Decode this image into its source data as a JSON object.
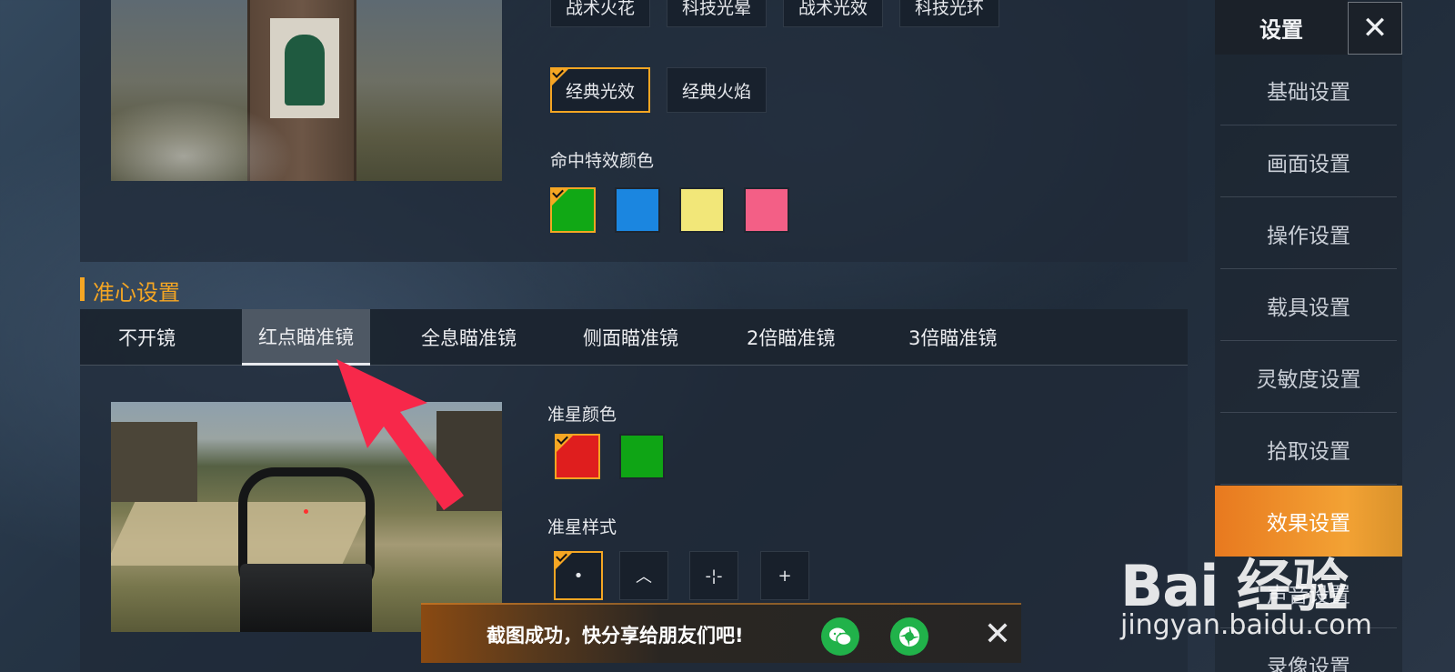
{
  "hit_effects": {
    "clipped_options": [
      "战术火花",
      "科技光晕",
      "战术光效",
      "科技光环"
    ],
    "options": [
      {
        "label": "经典光效",
        "selected": true
      },
      {
        "label": "经典火焰",
        "selected": false
      }
    ],
    "color_label": "命中特效颜色",
    "colors": [
      {
        "name": "green",
        "hex": "#11a815",
        "selected": true
      },
      {
        "name": "blue",
        "hex": "#1b86e0",
        "selected": false
      },
      {
        "name": "yellow",
        "hex": "#f2e779",
        "selected": false
      },
      {
        "name": "pink",
        "hex": "#f35f86",
        "selected": false
      }
    ]
  },
  "crosshair": {
    "section_title": "准心设置",
    "tabs": [
      "不开镜",
      "红点瞄准镜",
      "全息瞄准镜",
      "侧面瞄准镜",
      "2倍瞄准镜",
      "3倍瞄准镜"
    ],
    "active_tab": 1,
    "color_label": "准星颜色",
    "colors": [
      {
        "name": "red",
        "hex": "#df1e1e",
        "selected": true
      },
      {
        "name": "green",
        "hex": "#0fa515",
        "selected": false
      }
    ],
    "style_label": "准星样式",
    "styles": [
      {
        "name": "dot-icon",
        "glyph": "•",
        "selected": true
      },
      {
        "name": "chevron-up-icon",
        "glyph": "︿",
        "selected": false
      },
      {
        "name": "crosshair-gap-icon",
        "glyph": "-¦-",
        "selected": false
      },
      {
        "name": "crosshair-icon",
        "glyph": "+",
        "selected": false
      }
    ]
  },
  "sidebar": {
    "title": "设置",
    "close_glyph": "✕",
    "items": [
      "基础设置",
      "画面设置",
      "操作设置",
      "载具设置",
      "灵敏度设置",
      "拾取设置",
      "效果设置",
      "声音设置",
      "录像设置"
    ],
    "active_index": 6
  },
  "toast": {
    "text": "截图成功，快分享给朋友们吧!",
    "close_glyph": "✕"
  },
  "watermark": {
    "logo": "Bai 经验",
    "url": "jingyan.baidu.com"
  },
  "colors": {
    "accent": "#f5a623",
    "annotation_arrow": "#f7284a"
  }
}
